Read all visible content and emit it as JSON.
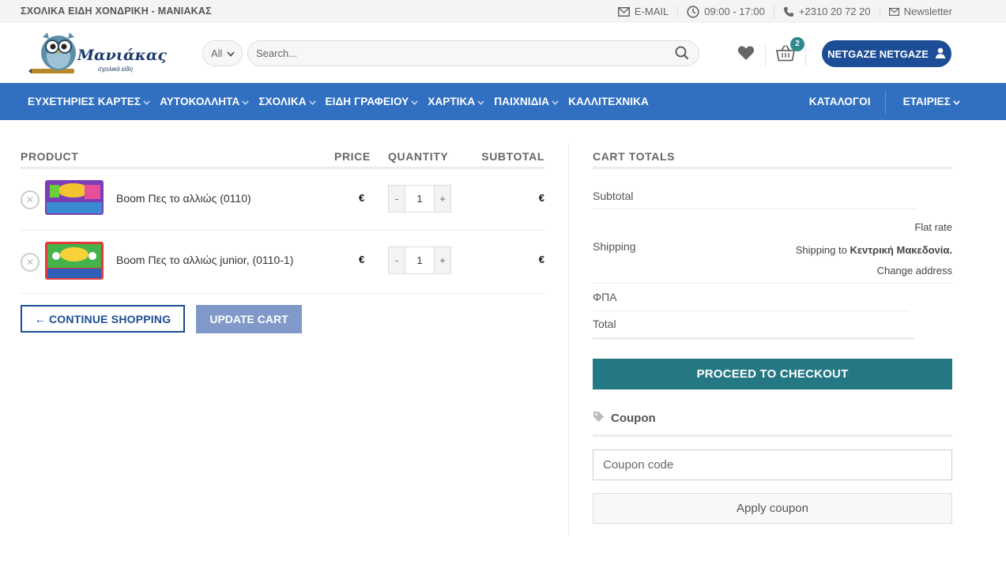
{
  "topbar": {
    "brand": "ΣΧΟΛΙΚΑ ΕΙΔΗ ΧΟΝΔΡΙΚΗ - ΜΑΝΙΑΚΑΣ",
    "email": "E-MAIL",
    "hours": "09:00 - 17:00",
    "phone": "+2310 20 72 20",
    "newsletter": "Newsletter"
  },
  "header": {
    "logo_text": "Μανιάκας",
    "logo_sub": "σχολικά είδη",
    "category_select": "All",
    "search_placeholder": "Search...",
    "cart_count": "2",
    "account_label": "NETGAZE NETGAZE"
  },
  "nav": {
    "items": [
      {
        "label": "ΕΥΧΕΤΗΡΙΕΣ ΚΑΡΤΕΣ",
        "has_dropdown": true
      },
      {
        "label": "ΑΥΤΟΚΟΛΛΗΤΑ",
        "has_dropdown": true
      },
      {
        "label": "ΣΧΟΛΙΚΑ",
        "has_dropdown": true
      },
      {
        "label": "ΕΙΔΗ ΓΡΑΦΕΙΟΥ",
        "has_dropdown": true
      },
      {
        "label": "ΧΑΡΤΙΚΑ",
        "has_dropdown": true
      },
      {
        "label": "ΠΑΙΧΝΙΔΙΑ",
        "has_dropdown": true
      },
      {
        "label": "ΚΑΛΛΙΤΕΧΝΙΚΑ",
        "has_dropdown": false
      }
    ],
    "right": [
      {
        "label": "ΚΑΤΑΛΟΓΟΙ"
      },
      {
        "label": "ΕΤΑΙΡΙΕΣ"
      }
    ]
  },
  "cart": {
    "headers": {
      "product": "PRODUCT",
      "price": "PRICE",
      "quantity": "QUANTITY",
      "subtotal": "SUBTOTAL"
    },
    "items": [
      {
        "name": "Boom Πες το αλλιώς (0110)",
        "price": "€",
        "quantity": "1",
        "subtotal": "€"
      },
      {
        "name": "Boom Πες το αλλιώς junior, (0110-1)",
        "price": "€",
        "quantity": "1",
        "subtotal": "€"
      }
    ],
    "continue_label": "← CONTINUE SHOPPING",
    "update_label": "UPDATE CART"
  },
  "totals": {
    "title": "CART TOTALS",
    "subtotal_label": "Subtotal",
    "shipping_label": "Shipping",
    "shipping_method": "Flat rate",
    "shipping_to_prefix": "Shipping to ",
    "shipping_region": "Κεντρική Μακεδονία.",
    "change_address": "Change address",
    "tax_label": "ΦΠΑ",
    "total_label": "Total",
    "checkout_label": "PROCEED TO CHECKOUT"
  },
  "coupon": {
    "title": "Coupon",
    "placeholder": "Coupon code",
    "apply_label": "Apply coupon"
  },
  "colors": {
    "nav_bg": "#3170c1",
    "account_bg": "#1c4d96",
    "checkout_bg": "#247883",
    "update_bg": "#8199c9",
    "badge_bg": "#2e8a8f"
  }
}
